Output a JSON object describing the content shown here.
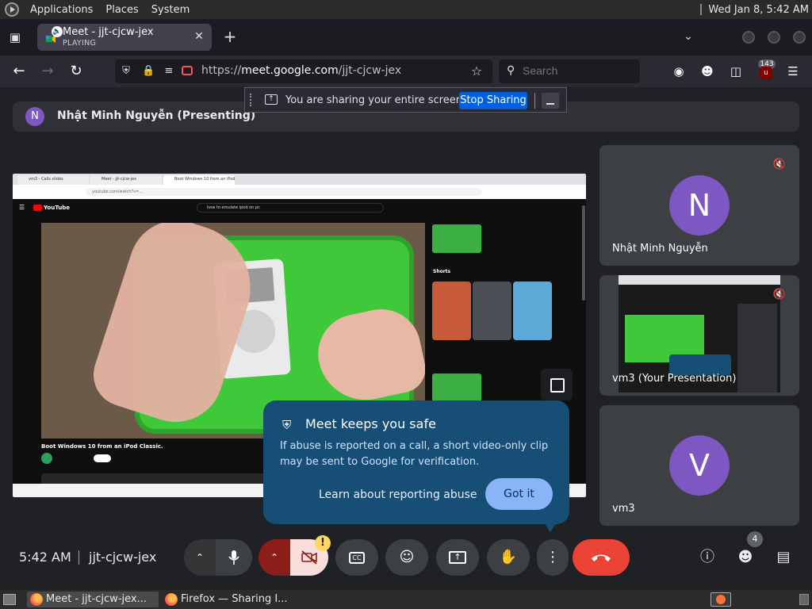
{
  "top_panel": {
    "menus": [
      "Applications",
      "Places",
      "System"
    ],
    "clock": "Wed Jan  8,  5:42 AM"
  },
  "browser": {
    "tab": {
      "title": "Meet - jjt-cjcw-jex",
      "status": "PLAYING",
      "audio_icon": "speaker-icon"
    },
    "url_prefix": "https://",
    "url_domain": "meet.google.com",
    "url_path": "/jjt-cjcw-jex",
    "search_placeholder": "Search",
    "extension_badge": "143"
  },
  "sharing_indicator": {
    "message": "You are sharing your entire screen.",
    "stop_label": "Stop Sharing"
  },
  "presenting_bar": {
    "avatar_letter": "N",
    "name": "Nhật Minh Nguyễn (Presenting)"
  },
  "shared_screen": {
    "tabs": [
      "vm3 - Calls slides",
      "Meet - jjt-cjcw-jex",
      "Boot Windows 10 from an iPod"
    ],
    "url": "youtube.com/watch?v=...",
    "yt_logo": "YouTube",
    "yt_search": "how to emulate ipod on pc",
    "video_title": "Boot Windows 10 from an iPod Classic.",
    "shorts_label": "Shorts"
  },
  "tiles": [
    {
      "letter": "N",
      "name": "Nhật Minh Nguyễn",
      "muted": true
    },
    {
      "name": "vm3 (Your Presentation)",
      "muted": true
    },
    {
      "letter": "V",
      "name": "vm3"
    }
  ],
  "safety_popup": {
    "title": "Meet keeps you safe",
    "body": "If abuse is reported on a call, a short video-only clip may be sent to Google for verification.",
    "learn_link": "Learn about reporting abuse",
    "got_it": "Got it"
  },
  "meeting": {
    "time": "5:42 AM",
    "code": "jjt-cjcw-jex",
    "camera_warning": "!",
    "people_count": "4"
  },
  "taskbar": {
    "tasks": [
      "Meet - jjt-cjcw-jex...",
      "Firefox — Sharing I..."
    ]
  },
  "colors": {
    "meet_background": "#202124",
    "tile_background": "#3c4043",
    "hangup_red": "#ea4335",
    "popup_blue": "#174e76",
    "got_it_blue": "#8ab4f8",
    "stop_sharing_blue": "#0060df",
    "avatar_purple": "#7e57c2"
  }
}
